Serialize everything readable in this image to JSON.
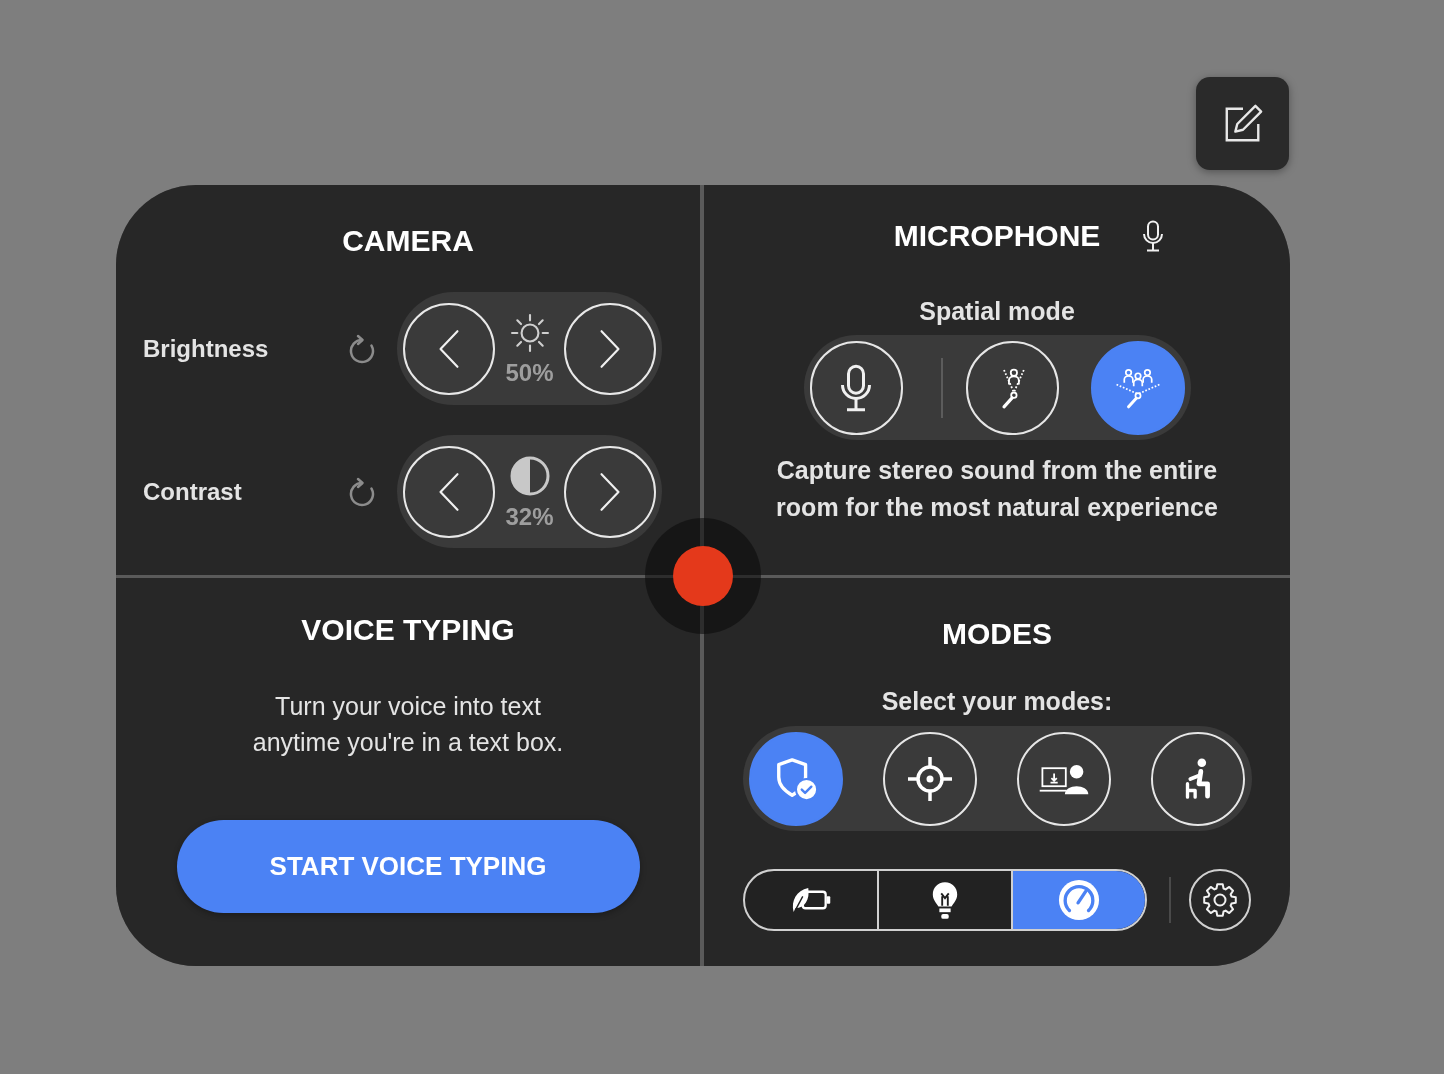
{
  "camera": {
    "title": "CAMERA",
    "controls": [
      {
        "kind": "brightness",
        "label": "Brightness",
        "value": "50%"
      },
      {
        "kind": "contrast",
        "label": "Contrast",
        "value": "32%"
      }
    ]
  },
  "microphone": {
    "title": "MICROPHONE",
    "subtitle": "Spatial mode",
    "spatial_modes": [
      {
        "kind": "single",
        "selected": false
      },
      {
        "kind": "focused",
        "selected": false
      },
      {
        "kind": "room",
        "selected": true
      }
    ],
    "description": "Capture stereo sound from the entire room for the most natural experience"
  },
  "voice_typing": {
    "title": "VOICE TYPING",
    "description": "Turn your voice into text anytime you're in a text box.",
    "button": "START VOICE TYPING"
  },
  "modes": {
    "title": "MODES",
    "subtitle": "Select your modes:",
    "modes": [
      {
        "kind": "shield",
        "selected": true
      },
      {
        "kind": "target",
        "selected": false
      },
      {
        "kind": "presenter",
        "selected": false
      },
      {
        "kind": "seated",
        "selected": false
      }
    ],
    "power_profiles": [
      {
        "kind": "battery_saver",
        "selected": false
      },
      {
        "kind": "balanced",
        "selected": false
      },
      {
        "kind": "performance",
        "selected": true
      }
    ]
  }
}
